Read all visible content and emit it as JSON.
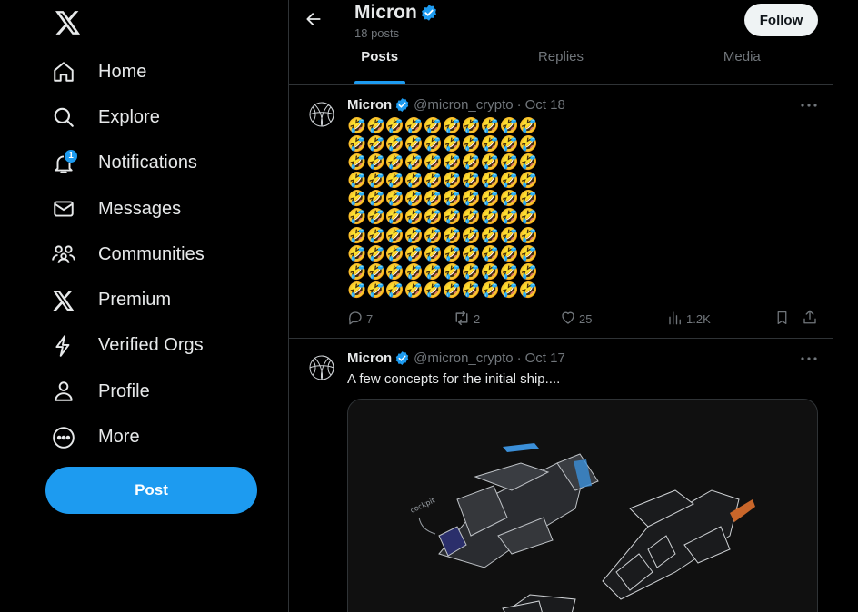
{
  "sidebar": {
    "logo_icon": "x-logo-icon",
    "items": [
      {
        "label": "Home",
        "icon": "home-icon"
      },
      {
        "label": "Explore",
        "icon": "search-icon"
      },
      {
        "label": "Notifications",
        "icon": "bell-icon",
        "badge": "1"
      },
      {
        "label": "Messages",
        "icon": "envelope-icon"
      },
      {
        "label": "Communities",
        "icon": "people-icon"
      },
      {
        "label": "Premium",
        "icon": "x-logo-icon"
      },
      {
        "label": "Verified Orgs",
        "icon": "lightning-icon"
      },
      {
        "label": "Profile",
        "icon": "person-icon"
      },
      {
        "label": "More",
        "icon": "more-circle-icon"
      }
    ],
    "post_button": "Post"
  },
  "header": {
    "name": "Micron",
    "post_count": "18 posts",
    "follow_label": "Follow"
  },
  "tabs": [
    {
      "label": "Posts",
      "active": true
    },
    {
      "label": "Replies",
      "active": false
    },
    {
      "label": "Media",
      "active": false
    }
  ],
  "posts": [
    {
      "name": "Micron",
      "handle": "@micron_crypto",
      "separator": "·",
      "date": "Oct 18",
      "text": "🤣🤣🤣🤣🤣🤣🤣🤣🤣🤣🤣🤣🤣🤣🤣🤣🤣🤣🤣🤣🤣🤣🤣🤣🤣🤣🤣🤣🤣🤣🤣🤣🤣🤣🤣🤣🤣🤣🤣🤣🤣🤣🤣🤣🤣🤣🤣🤣🤣🤣🤣🤣🤣🤣🤣🤣🤣🤣🤣🤣🤣🤣🤣🤣🤣🤣🤣🤣🤣🤣🤣🤣🤣🤣🤣🤣🤣🤣🤣🤣🤣🤣🤣🤣🤣🤣🤣🤣🤣🤣🤣🤣🤣🤣🤣🤣🤣🤣🤣🤣",
      "replies": "7",
      "reposts": "2",
      "likes": "25",
      "views": "1.2K"
    },
    {
      "name": "Micron",
      "handle": "@micron_crypto",
      "separator": "·",
      "date": "Oct 17",
      "text": "A few concepts for the initial ship....",
      "media_annotation": "cockpit"
    }
  ],
  "colors": {
    "accent": "#1d9bf0",
    "background": "#000000",
    "border": "#2f3336",
    "muted_text": "#71767b"
  }
}
